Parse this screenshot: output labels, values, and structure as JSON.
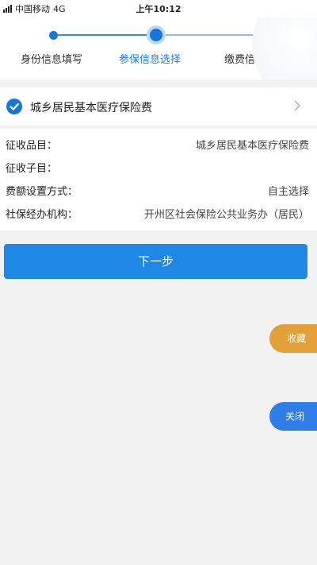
{
  "status_bar": {
    "carrier": "中国移动",
    "network": "4G",
    "time": "上午10:12"
  },
  "stepper": {
    "steps": [
      {
        "label": "身份信息填写",
        "state": "done"
      },
      {
        "label": "参保信息选择",
        "state": "active"
      },
      {
        "label": "缴费信",
        "state": "pending"
      }
    ]
  },
  "insurance": {
    "title": "城乡居民基本医疗保险费",
    "selected": true
  },
  "details": {
    "rows": [
      {
        "label": "征收品目：",
        "value": "城乡居民基本医疗保险费"
      },
      {
        "label": "征收子目：",
        "value": ""
      },
      {
        "label": "费额设置方式：",
        "value": "自主选择"
      },
      {
        "label": "社保经办机构：",
        "value": "开州区社会保险公共业务办（居民）"
      }
    ]
  },
  "actions": {
    "next_label": "下一步",
    "favorite_label": "收藏",
    "close_label": "关闭"
  },
  "colors": {
    "accent": "#1677d8",
    "button": "#1f87e5",
    "favorite": "#e3a039",
    "close": "#2f7de6",
    "background": "#f2f2f2"
  }
}
